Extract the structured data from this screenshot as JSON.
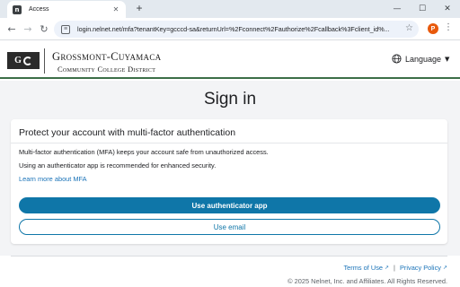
{
  "browser": {
    "tab": {
      "favicon_letter": "n",
      "title": "Access",
      "close_glyph": "✕"
    },
    "new_tab_glyph": "+",
    "window_controls": {
      "minimize": "—",
      "maximize": "☐",
      "close": "✕"
    },
    "nav": {
      "back": "←",
      "forward": "→",
      "reload": "↻"
    },
    "url": "login.nelnet.net/mfa?tenantKey=gcccd-sa&returnUrl=%2Fconnect%2Fauthorize%2Fcallback%3Fclient_id%...",
    "star_glyph": "☆",
    "profile_initial": "P",
    "menu_glyph": "⋮"
  },
  "header": {
    "logo_letter_left": "G",
    "logo_name_line1": "Grossmont-Cuyamaca",
    "logo_name_line2": "Community College District",
    "language_label": "Language",
    "caret_glyph": "▼"
  },
  "main": {
    "title": "Sign in",
    "card": {
      "heading": "Protect your account with multi-factor authentication",
      "text1": "Multi-factor authentication (MFA) keeps your account safe from unauthorized access.",
      "text2": "Using an authenticator app is recommended for enhanced security.",
      "learn_more_link": "Learn more about MFA",
      "primary_button": "Use authenticator app",
      "secondary_button": "Use email"
    }
  },
  "footer": {
    "terms_link": "Terms of Use",
    "privacy_link": "Privacy Policy",
    "separator": "|",
    "external_glyph": "↗",
    "copyright": "© 2025 Nelnet, Inc. and Affiliates. All Rights Reserved."
  },
  "colors": {
    "accent": "#0f76a8",
    "link": "#1a73b8",
    "header_rule": "#3c6e47"
  }
}
